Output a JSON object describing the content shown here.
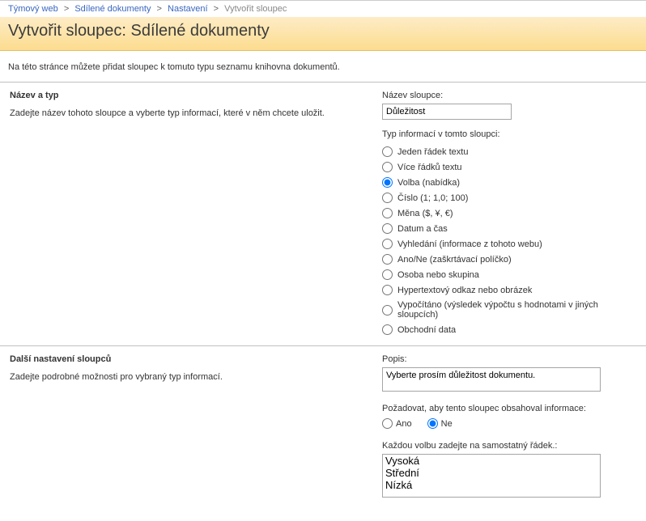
{
  "breadcrumbs": {
    "items": [
      {
        "label": "Týmový web"
      },
      {
        "label": "Sdílené dokumenty"
      },
      {
        "label": "Nastavení"
      }
    ],
    "current": "Vytvořit sloupec"
  },
  "pageTitle": "Vytvořit sloupec: Sdílené dokumenty",
  "pageDescription": "Na této stránce můžete přidat sloupec k tomuto typu seznamu knihovna dokumentů.",
  "section1": {
    "heading": "Název a typ",
    "subheading": "Zadejte název tohoto sloupce a vyberte typ informací, které v něm chcete uložit.",
    "nameLabel": "Název sloupce:",
    "nameValue": "Důležitost",
    "typeLabel": "Typ informací v tomto sloupci:",
    "typeOptions": [
      "Jeden řádek textu",
      "Více řádků textu",
      "Volba (nabídka)",
      "Číslo (1; 1,0; 100)",
      "Měna ($, ¥, €)",
      "Datum a čas",
      "Vyhledání (informace z tohoto webu)",
      "Ano/Ne (zaškrtávací políčko)",
      "Osoba nebo skupina",
      "Hypertextový odkaz nebo obrázek",
      "Vypočítáno (výsledek výpočtu s hodnotami v jiných sloupcích)",
      "Obchodní data"
    ],
    "typeSelectedIndex": 2
  },
  "section2": {
    "heading": "Další nastavení sloupců",
    "subheading": "Zadejte podrobné možnosti pro vybraný typ informací.",
    "descLabel": "Popis:",
    "descValue": "Vyberte prosím důležitost dokumentu.",
    "requireLabel": "Požadovat, aby tento sloupec obsahoval informace:",
    "yes": "Ano",
    "no": "Ne",
    "requireSelected": "no",
    "choicesLabel": "Každou volbu zadejte na samostatný řádek.:",
    "choicesValue": "Vysoká\nStřední\nNízká"
  }
}
